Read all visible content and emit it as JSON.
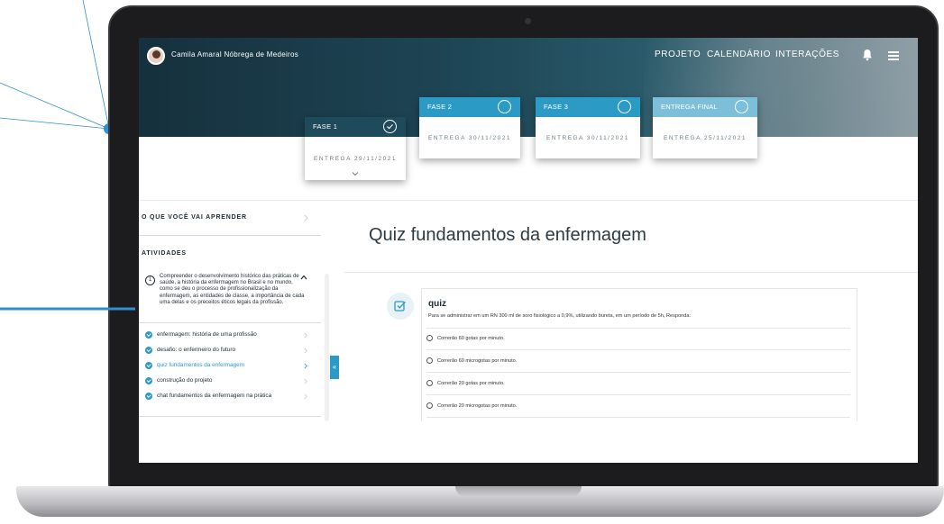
{
  "header": {
    "user_name": "Camila Amaral Nóbrega de Medeiros",
    "nav": [
      "PROJETO",
      "CALENDÁRIO",
      "INTERAÇÕES"
    ]
  },
  "phases": [
    {
      "title": "FASE 1",
      "date": "ENTREGA 29/11/2021",
      "color": "#1f4a5c",
      "done": true
    },
    {
      "title": "FASE 2",
      "date": "ENTREGA 30/11/2021",
      "color": "#2b9bc6",
      "done": false
    },
    {
      "title": "FASE 3",
      "date": "ENTREGA 30/11/2021",
      "color": "#2b9bc6",
      "done": false
    },
    {
      "title": "ENTREGA FINAL",
      "date": "ENTREGA 25/11/2021",
      "color": "#7dbfd8",
      "done": false
    }
  ],
  "sidebar": {
    "learn_title": "O QUE VOCÊ VAI APRENDER",
    "activities_title": "ATIVIDADES",
    "activity_number": "1",
    "activity_description": "Compreender o desenvolvimento histórico das práticas de saúde, a história da enfermagem no Brasil e no mundo, como se deu o processo de profissionalização da enfermagem, as entidades de classe, a importância de cada uma delas e os preceitos éticos legais da profissão.",
    "items": [
      {
        "label": "enfermagem: história de uma profissão"
      },
      {
        "label": "desafio: o enfermeiro do futuro"
      },
      {
        "label": "quiz fundamentos da enfermagem"
      },
      {
        "label": "construção do projeto"
      },
      {
        "label": "chat fundamentos da enfermagem na prática"
      }
    ],
    "active_index": 2,
    "collapse_glyph": "«"
  },
  "main": {
    "title": "Quiz fundamentos da enfermagem",
    "quiz_label": "quiz",
    "question": "Para se administrar em um RN 300 ml de soro fisiológico a 0,9%, utilizando bureta, em um período de 5h, Responda:",
    "options": [
      "Correrão 60 gotas por minuto.",
      "Correrão 60 microgotas por minuto.",
      "Correrão 20 gotas por minuto.",
      "Correrão 20 microgotas por minuto."
    ]
  },
  "colors": {
    "accent": "#2b9bc6",
    "dark": "#1f4a5c",
    "callout": "#2f8fd0"
  }
}
